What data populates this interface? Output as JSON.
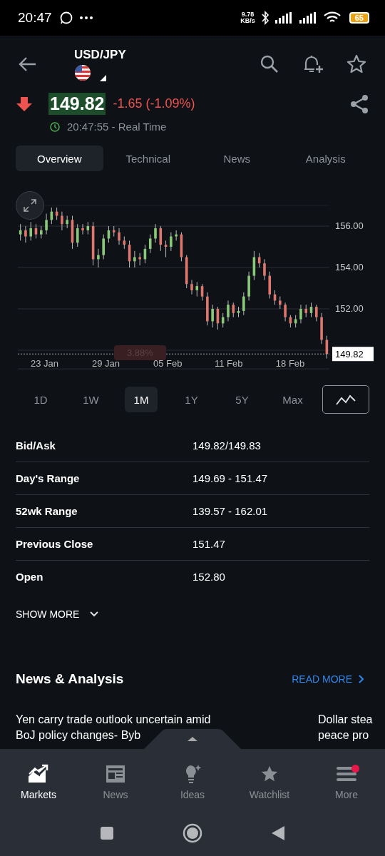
{
  "status_bar": {
    "time": "20:47",
    "speed": "9.78",
    "speed_unit": "KB/s",
    "battery": "65"
  },
  "header": {
    "symbol": "USD/JPY"
  },
  "quote": {
    "price": "149.82",
    "change": "-1.65 (-1.09%)",
    "time": "20:47:55 - Real Time"
  },
  "tabs": [
    {
      "label": "Overview",
      "selected": true
    },
    {
      "label": "Technical",
      "selected": false
    },
    {
      "label": "News",
      "selected": false
    },
    {
      "label": "Analysis",
      "selected": false
    }
  ],
  "chart": {
    "tooltip": "3.88%",
    "x_labels": [
      "23 Jan",
      "29 Jan",
      "05 Feb",
      "11 Feb",
      "18 Feb"
    ],
    "chart_data": {
      "type": "candlestick",
      "grid": true,
      "ylim": [
        149.1,
        157.0
      ],
      "ref_lines": [
        {
          "axis": "y",
          "value": 149.82,
          "label": "149.82"
        }
      ],
      "yticks": [
        {
          "value": 156,
          "label": "156.00"
        },
        {
          "value": 154,
          "label": "154.00"
        },
        {
          "value": 152,
          "label": "152.00"
        }
      ],
      "ohlc": [
        [
          155.6,
          156.1,
          155.3,
          155.8
        ],
        [
          155.8,
          156.0,
          155.2,
          155.5
        ],
        [
          155.5,
          156.2,
          155.3,
          155.9
        ],
        [
          155.9,
          156.1,
          155.4,
          155.6
        ],
        [
          155.6,
          156.0,
          155.4,
          155.8
        ],
        [
          155.8,
          156.6,
          155.6,
          156.3
        ],
        [
          156.3,
          156.9,
          156.1,
          156.7
        ],
        [
          156.7,
          156.9,
          156.3,
          156.5
        ],
        [
          156.5,
          156.7,
          155.8,
          156.1
        ],
        [
          156.1,
          156.5,
          155.9,
          156.3
        ],
        [
          156.3,
          156.5,
          154.9,
          155.2
        ],
        [
          155.2,
          156.1,
          155.0,
          155.9
        ],
        [
          155.9,
          156.1,
          155.6,
          155.8
        ],
        [
          155.8,
          156.2,
          155.6,
          156.0
        ],
        [
          156.0,
          156.2,
          154.1,
          154.4
        ],
        [
          154.4,
          154.9,
          154.0,
          154.6
        ],
        [
          154.6,
          155.6,
          154.4,
          155.4
        ],
        [
          155.4,
          156.0,
          155.2,
          155.8
        ],
        [
          155.8,
          156.0,
          155.5,
          155.7
        ],
        [
          155.7,
          155.9,
          155.1,
          155.3
        ],
        [
          155.3,
          155.5,
          154.9,
          155.1
        ],
        [
          155.1,
          155.3,
          154.0,
          154.3
        ],
        [
          154.3,
          154.8,
          154.0,
          154.5
        ],
        [
          154.5,
          154.7,
          154.1,
          154.4
        ],
        [
          154.4,
          155.1,
          154.2,
          154.9
        ],
        [
          154.9,
          155.6,
          154.7,
          155.4
        ],
        [
          155.4,
          156.1,
          155.2,
          155.9
        ],
        [
          155.9,
          156.0,
          154.8,
          155.1
        ],
        [
          155.1,
          155.3,
          154.5,
          155.0
        ],
        [
          155.0,
          155.7,
          154.8,
          155.5
        ],
        [
          155.5,
          155.8,
          155.3,
          155.6
        ],
        [
          155.6,
          155.7,
          154.3,
          154.5
        ],
        [
          154.5,
          154.6,
          153.0,
          153.2
        ],
        [
          153.2,
          153.4,
          152.7,
          152.9
        ],
        [
          152.9,
          153.3,
          152.6,
          153.1
        ],
        [
          153.1,
          153.2,
          152.4,
          152.6
        ],
        [
          152.6,
          152.8,
          151.2,
          151.4
        ],
        [
          151.4,
          152.2,
          151.1,
          152.0
        ],
        [
          152.0,
          152.1,
          151.0,
          151.3
        ],
        [
          151.3,
          151.8,
          151.1,
          151.6
        ],
        [
          151.6,
          152.4,
          151.4,
          152.2
        ],
        [
          152.2,
          152.3,
          151.6,
          151.8
        ],
        [
          151.8,
          152.1,
          151.6,
          151.9
        ],
        [
          151.9,
          152.8,
          151.7,
          152.6
        ],
        [
          152.6,
          153.8,
          152.4,
          153.6
        ],
        [
          153.6,
          154.8,
          153.4,
          154.5
        ],
        [
          154.5,
          154.7,
          154.0,
          154.2
        ],
        [
          154.2,
          154.4,
          153.4,
          153.6
        ],
        [
          153.6,
          153.8,
          152.5,
          152.7
        ],
        [
          152.7,
          152.9,
          152.2,
          152.4
        ],
        [
          152.4,
          152.6,
          152.0,
          152.2
        ],
        [
          152.2,
          152.3,
          151.4,
          151.6
        ],
        [
          151.6,
          151.7,
          151.1,
          151.3
        ],
        [
          151.3,
          151.7,
          151.1,
          151.5
        ],
        [
          151.5,
          152.2,
          151.3,
          152.0
        ],
        [
          152.0,
          152.2,
          151.6,
          151.8
        ],
        [
          151.8,
          152.3,
          151.6,
          152.1
        ],
        [
          152.1,
          152.2,
          151.4,
          151.6
        ],
        [
          151.6,
          151.8,
          150.3,
          150.5
        ],
        [
          150.5,
          150.7,
          149.6,
          149.82
        ]
      ]
    }
  },
  "ranges": [
    {
      "label": "1D",
      "selected": false
    },
    {
      "label": "1W",
      "selected": false
    },
    {
      "label": "1M",
      "selected": true
    },
    {
      "label": "1Y",
      "selected": false
    },
    {
      "label": "5Y",
      "selected": false
    },
    {
      "label": "Max",
      "selected": false
    }
  ],
  "stats": [
    {
      "label": "Bid/Ask",
      "value": "149.82/149.83"
    },
    {
      "label": "Day's Range",
      "value": "149.69 - 151.47"
    },
    {
      "label": "52wk Range",
      "value": "139.57 - 162.01"
    },
    {
      "label": "Previous Close",
      "value": "151.47"
    },
    {
      "label": "Open",
      "value": "152.80"
    }
  ],
  "show_more": "SHOW MORE",
  "news": {
    "title": "News & Analysis",
    "read_more": "READ MORE",
    "items": [
      {
        "lines": [
          "Yen carry trade outlook uncertain amid",
          "BoJ policy changes- Byb"
        ]
      },
      {
        "lines": [
          "Dollar stea",
          "peace pro"
        ]
      }
    ]
  },
  "bottom_nav": [
    {
      "label": "Markets",
      "selected": true,
      "badge": false
    },
    {
      "label": "News",
      "selected": false,
      "badge": false
    },
    {
      "label": "Ideas",
      "selected": false,
      "badge": false
    },
    {
      "label": "Watchlist",
      "selected": false,
      "badge": false
    },
    {
      "label": "More",
      "selected": false,
      "badge": true
    }
  ]
}
